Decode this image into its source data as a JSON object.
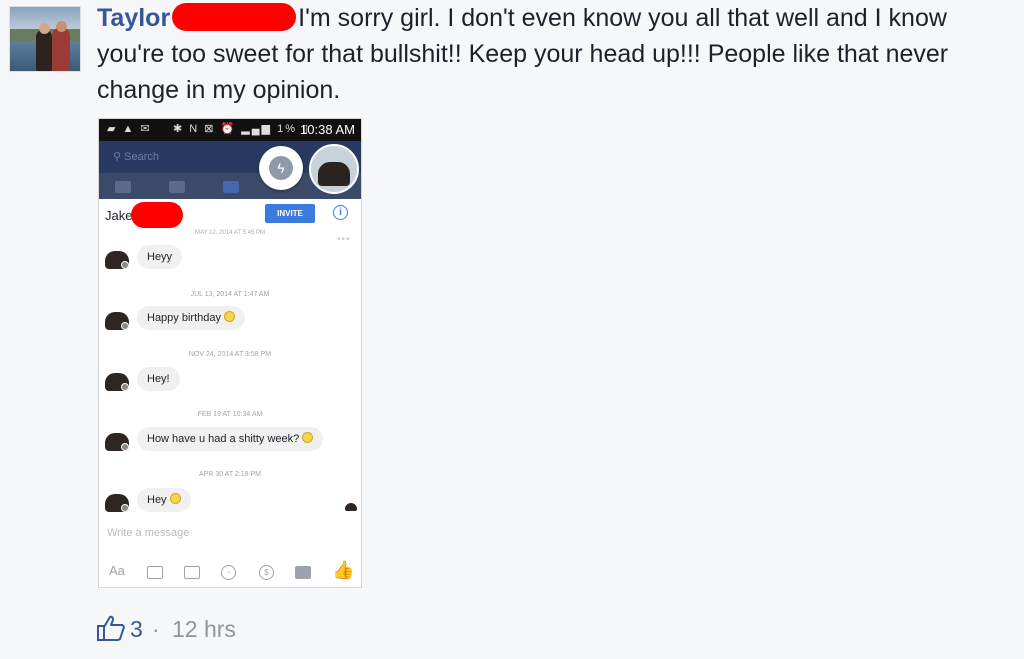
{
  "comment": {
    "author": "Taylor",
    "text": "I'm sorry girl. I don't even know you all that well and I know you're too sweet for that bullshit!! Keep your head up!!! People like that never change in my opinion.",
    "like_count": "3",
    "separator": "·",
    "age": "12 hrs"
  },
  "screenshot": {
    "status_time": "10:38 AM",
    "status_battery": "1%",
    "search_placeholder": "Search",
    "contact_name": "Jake",
    "invite_label": "INVITE",
    "info_label": "i",
    "first_timestamp": "MAY 12, 2014 AT 5:45 PM",
    "messages": [
      {
        "timestamp": "",
        "text": "Heyy"
      },
      {
        "timestamp": "JUL 13, 2014 AT 1:47 AM",
        "text": "Happy birthday"
      },
      {
        "timestamp": "NOV 24, 2014 AT 3:58 PM",
        "text": "Hey!"
      },
      {
        "timestamp": "FEB 19 AT 10:34 AM",
        "text": "How have u had a shitty week?"
      },
      {
        "timestamp": "APR 30 AT 2:18 PM",
        "text": "Hey"
      }
    ],
    "composer_placeholder": "Write a message",
    "toolbar": [
      "Aa",
      "camera-icon",
      "gallery-icon",
      "smiley-icon",
      "payment-icon",
      "more-icon",
      "thumbs-up-icon"
    ],
    "toolbar_aa": "Aa",
    "toolbar_payment": "$"
  },
  "colors": {
    "author": "#365899",
    "redaction": "#ff0000",
    "accent": "#3b7bdf"
  }
}
